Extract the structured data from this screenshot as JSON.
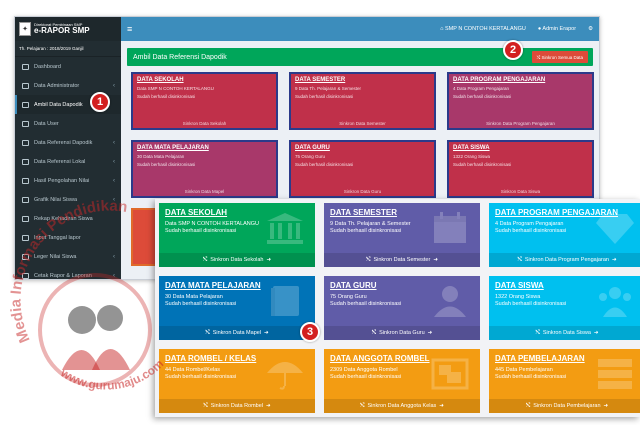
{
  "app": {
    "brand_line1": "Direktorat Pembinaan SMP",
    "brand_line2": "e-RAPOR SMP",
    "tahun_pelajaran": "Th. Pelajaran : 2018/2019 Ganjil",
    "school": "SMP N CONTOH KERTALANGU",
    "user": "Admin Erapor"
  },
  "sidebar": {
    "items": [
      {
        "label": "Dashboard",
        "chevron": ""
      },
      {
        "label": "Data Administrator",
        "chevron": "‹"
      },
      {
        "label": "Ambil Data Dapodik",
        "chevron": ""
      },
      {
        "label": "Data User",
        "chevron": ""
      },
      {
        "label": "Data Referensi Dapodik",
        "chevron": "‹"
      },
      {
        "label": "Data Referensi Lokal",
        "chevron": "‹"
      },
      {
        "label": "Hasil Pengolahan Nilai",
        "chevron": "‹"
      },
      {
        "label": "Grafik Nilai Siswa",
        "chevron": "‹"
      },
      {
        "label": "Rekap Kehadiran Siswa",
        "chevron": ""
      },
      {
        "label": "Input Tanggal lapor",
        "chevron": ""
      },
      {
        "label": "Leger Nilai Siswa",
        "chevron": "‹"
      },
      {
        "label": "Cetak Rapor & Laporan",
        "chevron": "‹"
      }
    ]
  },
  "panel": {
    "title": "Ambil Data Referensi Dapodik",
    "sync_all": "Sinkron Semua Data"
  },
  "background_cards": [
    {
      "title": "DATA SEKOLAH",
      "desc": "Data SMP N CONTOH KERTALANGU",
      "status": "Sudah berhasil disinkronisasi",
      "foot": "Sinkron Data Sekolah"
    },
    {
      "title": "DATA SEMESTER",
      "desc": "9 Data Th. Pelajaran & Semester",
      "status": "Sudah berhasil disinkronisasi",
      "foot": "Sinkron Data Semester"
    },
    {
      "title": "DATA PROGRAM PENGAJARAN",
      "desc": "4 Data Program Pengajaran",
      "status": "Sudah berhasil disinkronisasi",
      "foot": "Sinkron Data Program Pengajaran"
    },
    {
      "title": "DATA MATA PELAJARAN",
      "desc": "30 Data Mata Pelajaran",
      "status": "Sudah berhasil disinkronisasi",
      "foot": "Sinkron Data Mapel"
    },
    {
      "title": "DATA GURU",
      "desc": "75 Orang Guru",
      "status": "Sudah berhasil disinkronisasi",
      "foot": "Sinkron Data Guru"
    },
    {
      "title": "DATA SISWA",
      "desc": "1322 Orang Siswa",
      "status": "Sudah berhasil disinkronisasi",
      "foot": "Sinkron Data Siswa"
    }
  ],
  "cards": [
    {
      "title": "DATA SEKOLAH",
      "desc": "Data SMP N CONTOH KERTALANGU",
      "status": "Sudah berhasil disinkronisasi",
      "foot": "Sinkron Data Sekolah",
      "color": "#00a65a",
      "icon": "building-icon"
    },
    {
      "title": "DATA SEMESTER",
      "desc": "9 Data Th. Pelajaran & Semester",
      "status": "Sudah berhasil disinkronisasi",
      "foot": "Sinkron Data Semester",
      "color": "#605ca8",
      "icon": "calendar-icon"
    },
    {
      "title": "DATA PROGRAM PENGAJARAN",
      "desc": "4 Data Program Pengajaran",
      "status": "Sudah berhasil disinkronisasi",
      "foot": "Sinkron Data Program Pengajaran",
      "color": "#00c0ef",
      "icon": "diamond-icon"
    },
    {
      "title": "DATA MATA PELAJARAN",
      "desc": "30 Data Mata Pelajaran",
      "status": "Sudah berhasil disinkronisasi",
      "foot": "Sinkron Data Mapel",
      "color": "#0073b7",
      "icon": "book-icon"
    },
    {
      "title": "DATA GURU",
      "desc": "75 Orang Guru",
      "status": "Sudah berhasil disinkronisasi",
      "foot": "Sinkron Data Guru",
      "color": "#605ca8",
      "icon": "users-icon"
    },
    {
      "title": "DATA SISWA",
      "desc": "1322 Orang Siswa",
      "status": "Sudah berhasil disinkronisasi",
      "foot": "Sinkron Data Siswa",
      "color": "#00c0ef",
      "icon": "group-icon"
    },
    {
      "title": "DATA ROMBEL / KELAS",
      "desc": "44 Data Rombel/Kelas",
      "status": "Sudah berhasil disinkronisasi",
      "foot": "Sinkron Data Rombel",
      "color": "#f39c12",
      "icon": "umbrella-icon"
    },
    {
      "title": "DATA ANGGOTA ROMBEL",
      "desc": "2309 Data Anggota Rombel",
      "status": "Sudah berhasil disinkronisasi",
      "foot": "Sinkron Data Anggota Kelas",
      "color": "#f39c12",
      "icon": "object-group-icon"
    },
    {
      "title": "DATA PEMBELAJARAN",
      "desc": "445 Data Pembelajaran",
      "status": "Sudah berhasil disinkronisasi",
      "foot": "Sinkron Data Pembelajaran",
      "color": "#f39c12",
      "icon": "server-icon"
    }
  ],
  "badges": [
    "1",
    "2",
    "3"
  ],
  "watermark": {
    "line1": "Media Informasi Pendidikan",
    "line2": "www.gurumaju.com"
  }
}
